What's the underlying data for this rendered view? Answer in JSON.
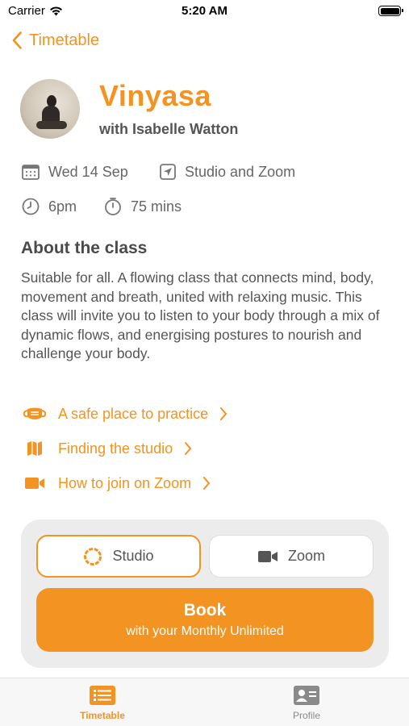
{
  "status_bar": {
    "carrier": "Carrier",
    "time": "5:20 AM"
  },
  "nav": {
    "back_label": "Timetable"
  },
  "class": {
    "title": "Vinyasa",
    "instructor": "with Isabelle Watton",
    "date": "Wed 14 Sep",
    "location": "Studio and Zoom",
    "time": "6pm",
    "duration": "75 mins"
  },
  "about": {
    "heading": "About the class",
    "text": "Suitable for all. A flowing class that connects mind, body, movement and breath, united with relaxing music. This class will invite you to listen to your body through a mix of dynamic flows, and energising postures to nourish and challenge your body."
  },
  "links": [
    {
      "label": "A safe place to practice",
      "icon": "mask-icon"
    },
    {
      "label": "Finding the studio",
      "icon": "map-icon"
    },
    {
      "label": "How to join on Zoom",
      "icon": "video-icon"
    }
  ],
  "booking": {
    "options": [
      {
        "label": "Studio",
        "selected": true
      },
      {
        "label": "Zoom",
        "selected": false
      }
    ],
    "book_label": "Book",
    "book_sublabel": "with your Monthly Unlimited"
  },
  "tabbar": {
    "items": [
      {
        "label": "Timetable",
        "active": true
      },
      {
        "label": "Profile",
        "active": false
      }
    ]
  },
  "colors": {
    "accent": "#f39322",
    "card_bg": "#ececec",
    "text": "#555555"
  }
}
